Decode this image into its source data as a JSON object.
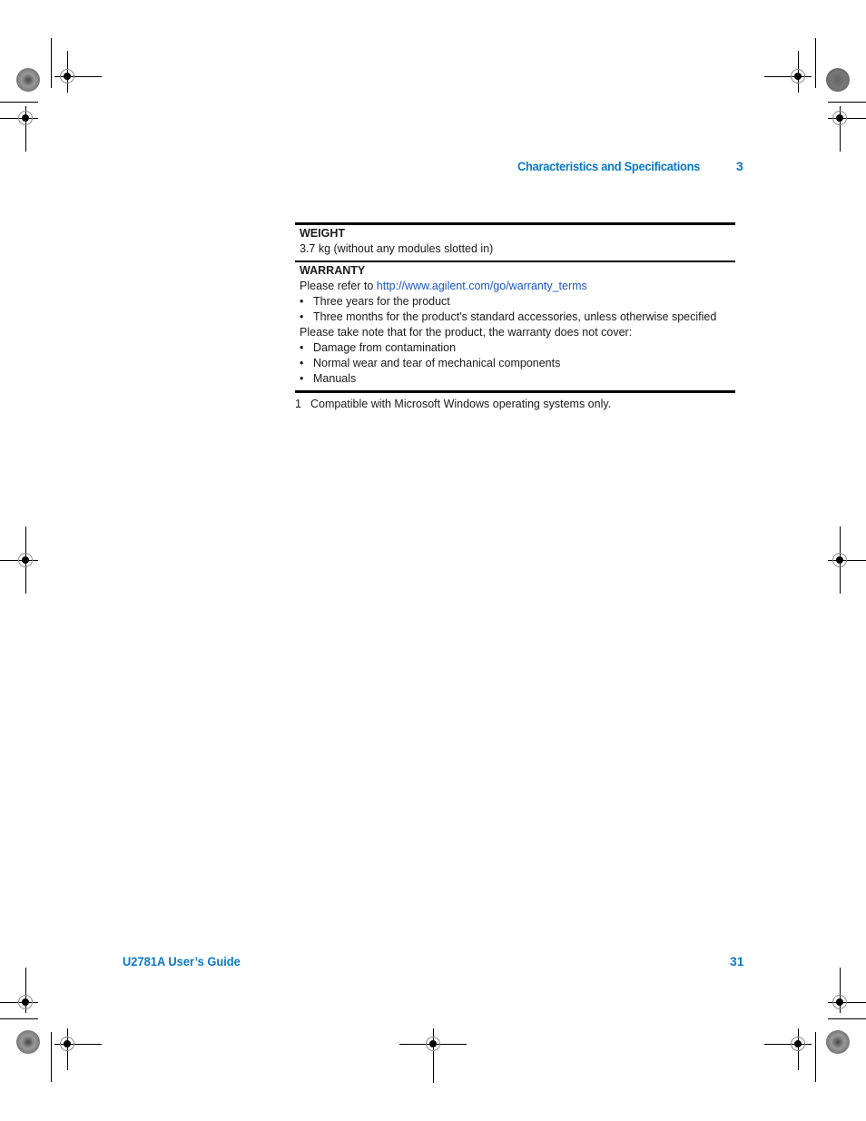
{
  "header": {
    "section_title": "Characteristics and Specifications",
    "chapter_number": "3"
  },
  "spec_table": {
    "weight": {
      "heading": "WEIGHT",
      "value": "3.7 kg (without any modules slotted in)"
    },
    "warranty": {
      "heading": "WARRANTY",
      "refer_prefix": "Please refer to ",
      "refer_link": "http://www.agilent.com/go/warranty_terms",
      "covered": [
        "Three years for the product",
        "Three months for the product's standard accessories, unless otherwise specified"
      ],
      "not_covered_intro": "Please take note that for the product, the warranty does not cover:",
      "not_covered": [
        "Damage from contamination",
        "Normal wear and tear of mechanical components",
        "Manuals"
      ],
      "bullet_glyph": "•"
    }
  },
  "footnote": {
    "number": "1",
    "text": "Compatible with Microsoft Windows operating systems only."
  },
  "footer": {
    "guide_title": "U2781A User’s Guide",
    "page_number": "31"
  },
  "colors": {
    "accent_blue": "#0a78c8",
    "link_blue": "#1a56c4"
  }
}
